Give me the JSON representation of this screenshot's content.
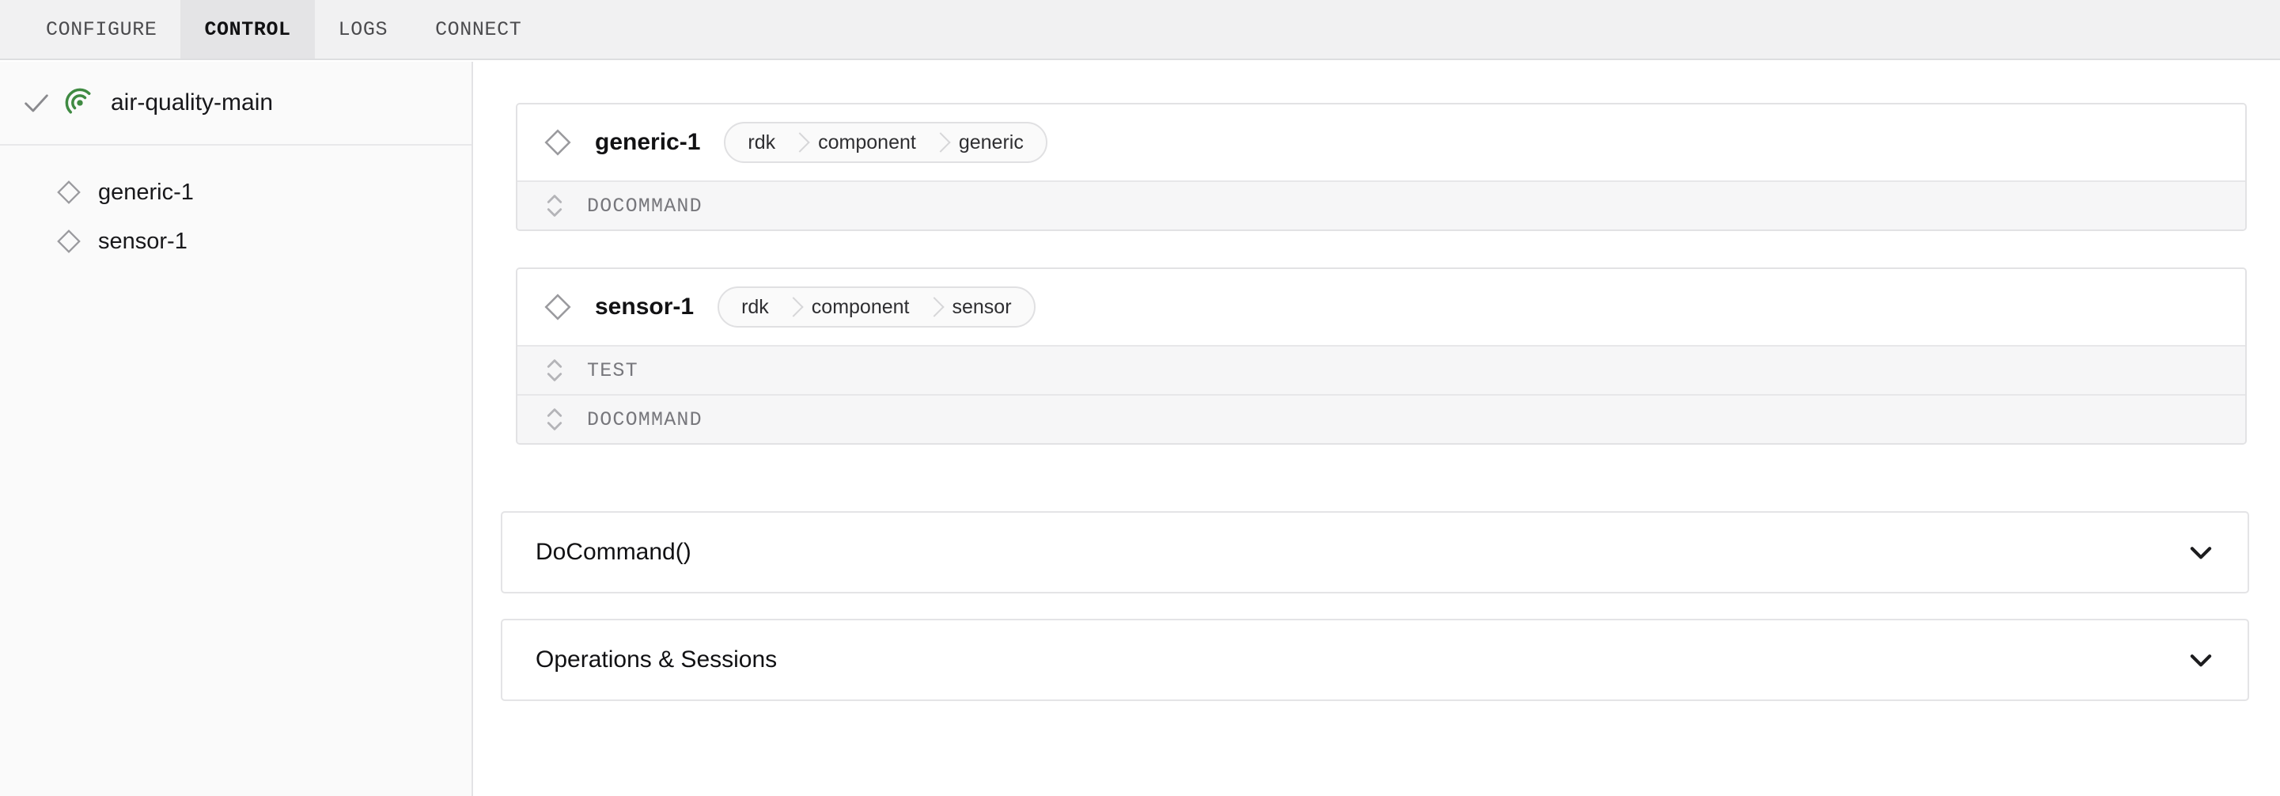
{
  "tabs": [
    {
      "label": "CONFIGURE",
      "active": false
    },
    {
      "label": "CONTROL",
      "active": true
    },
    {
      "label": "LOGS",
      "active": false
    },
    {
      "label": "CONNECT",
      "active": false
    }
  ],
  "sidebar": {
    "machine": {
      "name": "air-quality-main",
      "status_icon": "check-icon",
      "type_icon": "radiate-icon",
      "accent_color": "#3f8a42"
    },
    "components": [
      {
        "label": "generic-1",
        "icon": "diamond-icon"
      },
      {
        "label": "sensor-1",
        "icon": "diamond-icon"
      }
    ]
  },
  "main": {
    "cards": [
      {
        "title": "generic-1",
        "icon": "diamond-icon",
        "breadcrumbs": [
          "rdk",
          "component",
          "generic"
        ],
        "methods": [
          "DOCOMMAND"
        ]
      },
      {
        "title": "sensor-1",
        "icon": "diamond-icon",
        "breadcrumbs": [
          "rdk",
          "component",
          "sensor"
        ],
        "methods": [
          "TEST",
          "DOCOMMAND"
        ]
      }
    ],
    "accordions": [
      {
        "title": "DoCommand()",
        "icon": "chevron-down-icon",
        "expanded": false
      },
      {
        "title": "Operations & Sessions",
        "icon": "chevron-down-icon",
        "expanded": false
      }
    ]
  }
}
